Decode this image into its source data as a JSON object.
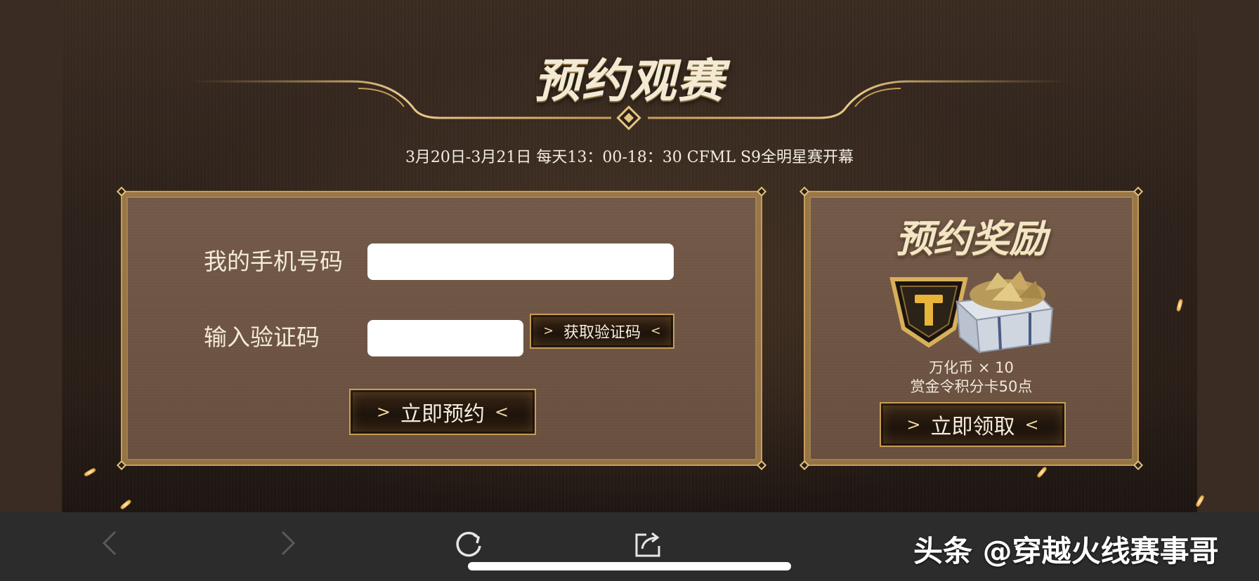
{
  "header": {
    "title": "预约观赛",
    "subtitle": "3月20日-3月21日 每天13：00-18：30 CFML S9全明星赛开幕"
  },
  "form": {
    "phone_label": "我的手机号码",
    "code_label": "输入验证码",
    "phone_value": "",
    "code_value": "",
    "get_code_label": "获取验证码",
    "reserve_label": "立即预约"
  },
  "reward": {
    "title": "预约奖励",
    "line1": "万化币 × 10",
    "line2": "赏金令积分卡50点",
    "claim_label": "立即领取"
  },
  "bottom_bar": {
    "icons": [
      "back-arrow-icon",
      "forward-arrow-icon",
      "refresh-icon",
      "share-icon"
    ],
    "watermark": "头条 @穿越火线赛事哥"
  },
  "colors": {
    "gold": "#c89d55",
    "panel": "#705543",
    "background": "#2a1f18",
    "bar": "#2c2c2c"
  }
}
